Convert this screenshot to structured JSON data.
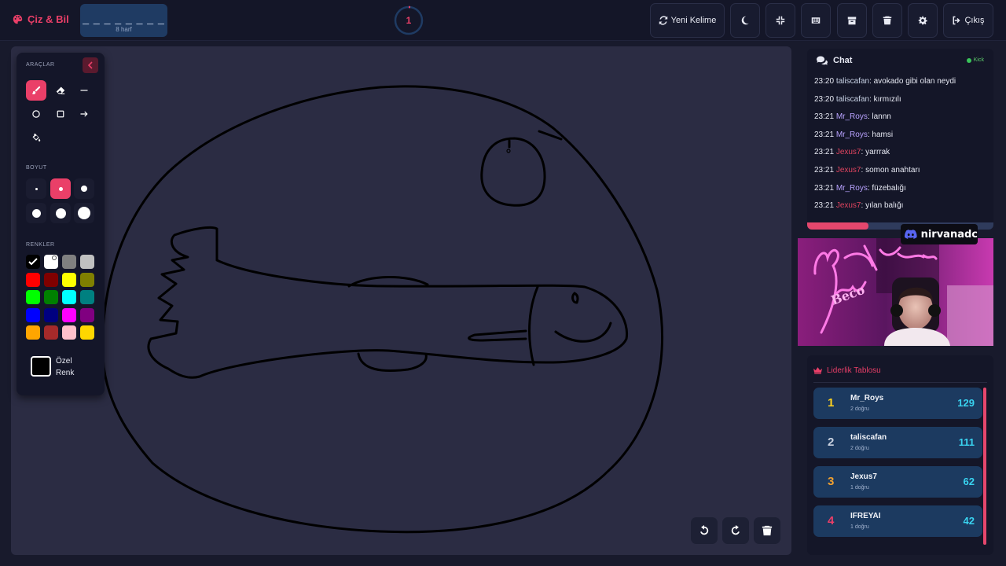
{
  "app": {
    "title": "Çiz & Bil"
  },
  "word_hint": {
    "dashes": "_ _ _ _ _ _ _ _",
    "letter_count": "8 harf"
  },
  "timer": {
    "value": "1"
  },
  "topbar": {
    "new_word_label": "Yeni Kelime",
    "exit_label": "Çıkış",
    "icons": [
      "refresh-icon",
      "moon-icon",
      "compress-icon",
      "keyboard-icon",
      "archive-icon",
      "trash-icon",
      "gear-icon",
      "sign-out-icon"
    ]
  },
  "toolbox": {
    "tools_heading": "ARAÇLAR",
    "size_heading": "BOYUT",
    "colors_heading": "RENKLER",
    "custom_color_label": "Özel Renk",
    "tools": [
      "brush",
      "eraser",
      "line",
      "circle",
      "rectangle",
      "arrow",
      "fill"
    ],
    "active_tool": "brush",
    "active_size_index": 1,
    "colors": [
      "#000000",
      "#ffffff",
      "#808080",
      "#c0c0c0",
      "#ff0000",
      "#800000",
      "#ffff00",
      "#808000",
      "#00ff00",
      "#008000",
      "#00ffff",
      "#008080",
      "#0000ff",
      "#000080",
      "#ff00ff",
      "#800080",
      "#ffa500",
      "#a52a2a",
      "#ffc0cb",
      "#ffd700"
    ],
    "selected_color": "#000000"
  },
  "canvas": {
    "background": "#2b2c43",
    "stroke_color": "#000000"
  },
  "chat": {
    "title": "Chat",
    "platform": "Kick",
    "messages": [
      {
        "time": "23:20",
        "user": "taliscafan",
        "user_color": "#c9d3e6",
        "text": "avokado gibi olan neydi"
      },
      {
        "time": "23:20",
        "user": "taliscafan",
        "user_color": "#c9d3e6",
        "text": "kırmızılı"
      },
      {
        "time": "23:21",
        "user": "Mr_Roys",
        "user_color": "#b9a3ff",
        "text": "lannn"
      },
      {
        "time": "23:21",
        "user": "Mr_Roys",
        "user_color": "#b9a3ff",
        "text": "hamsi"
      },
      {
        "time": "23:21",
        "user": "Jexus7",
        "user_color": "#e0445f",
        "text": "yarrrak"
      },
      {
        "time": "23:21",
        "user": "Jexus7",
        "user_color": "#e0445f",
        "text": "somon anahtarı"
      },
      {
        "time": "23:21",
        "user": "Mr_Roys",
        "user_color": "#b9a3ff",
        "text": "füzebalığı"
      },
      {
        "time": "23:21",
        "user": "Jexus7",
        "user_color": "#e0445f",
        "text": "yılan balığı"
      }
    ],
    "round_progress": 0.33
  },
  "stream_overlay": {
    "discord_name": "nirvanadc"
  },
  "leaderboard": {
    "title": "Liderlik Tablosu",
    "rows": [
      {
        "rank": "1",
        "name": "Mr_Roys",
        "sub": "2 doğru",
        "score": "129",
        "rank_color": "#ffd21f"
      },
      {
        "rank": "2",
        "name": "taliscafan",
        "sub": "2 doğru",
        "score": "111",
        "rank_color": "#c8d0de"
      },
      {
        "rank": "3",
        "name": "Jexus7",
        "sub": "1 doğru",
        "score": "62",
        "rank_color": "#f0a030"
      },
      {
        "rank": "4",
        "name": "IFREYAI",
        "sub": "1 doğru",
        "score": "42",
        "rank_color": "#ea3f68"
      }
    ]
  }
}
